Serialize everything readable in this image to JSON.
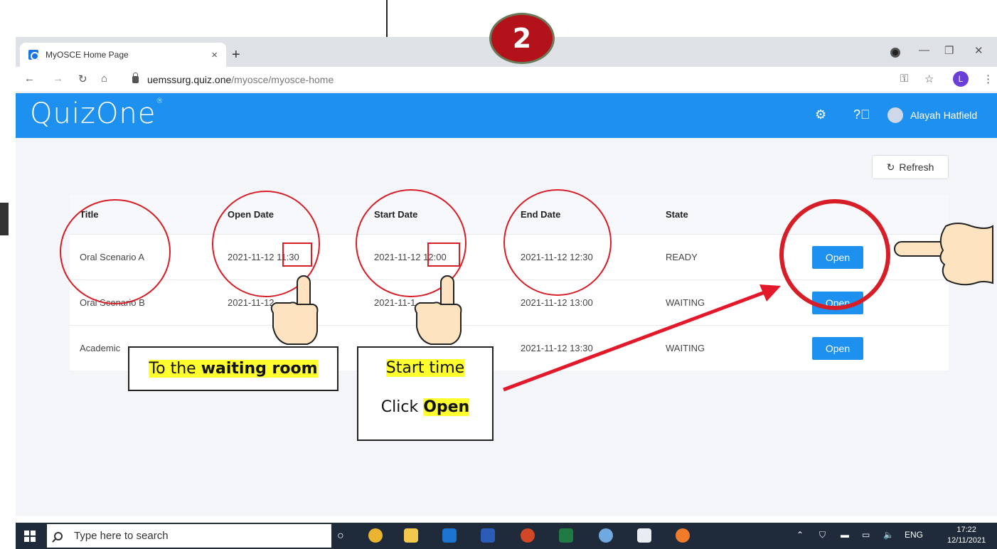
{
  "step_badge": "2",
  "browser": {
    "tab_title": "MyOSCE Home Page",
    "tab_close": "×",
    "new_tab": "+",
    "url_domain": "uemssurg.quiz.one",
    "url_path": "/myosce/myosce-home",
    "profile_initial": "L"
  },
  "app": {
    "logo": "QuizOne",
    "user_name": "Alayah Hatfield",
    "refresh_label": "Refresh"
  },
  "table": {
    "headers": [
      "Title",
      "Open Date",
      "Start Date",
      "End Date",
      "State"
    ],
    "rows": [
      {
        "title": "Oral Scenario A",
        "open": "2021-11-12 11:30",
        "start": "2021-11-12 12:00",
        "end": "2021-11-12 12:30",
        "state": "READY",
        "action": "Open"
      },
      {
        "title": "Oral Scenario B",
        "open": "2021-11-12 ",
        "start": "2021-11-1",
        "end": "2021-11-12 13:00",
        "state": "WAITING",
        "action": "Open"
      },
      {
        "title": "Academic",
        "open": "",
        "start": "",
        "end": "2021-11-12 13:30",
        "state": "WAITING",
        "action": "Open"
      }
    ]
  },
  "callouts": {
    "waiting_prefix": "To the ",
    "waiting_bold": "waiting room",
    "start_time": "Start time",
    "click_prefix": "Click ",
    "click_bold": "Open"
  },
  "taskbar": {
    "search_placeholder": "Type here to search",
    "language": "ENG",
    "time": "17:22",
    "date": "12/11/2021"
  },
  "colors": {
    "header_blue": "#1e90f0",
    "annotation_red": "#d71e27",
    "highlight_yellow": "#ffff2e",
    "badge_red": "#b3121a"
  }
}
